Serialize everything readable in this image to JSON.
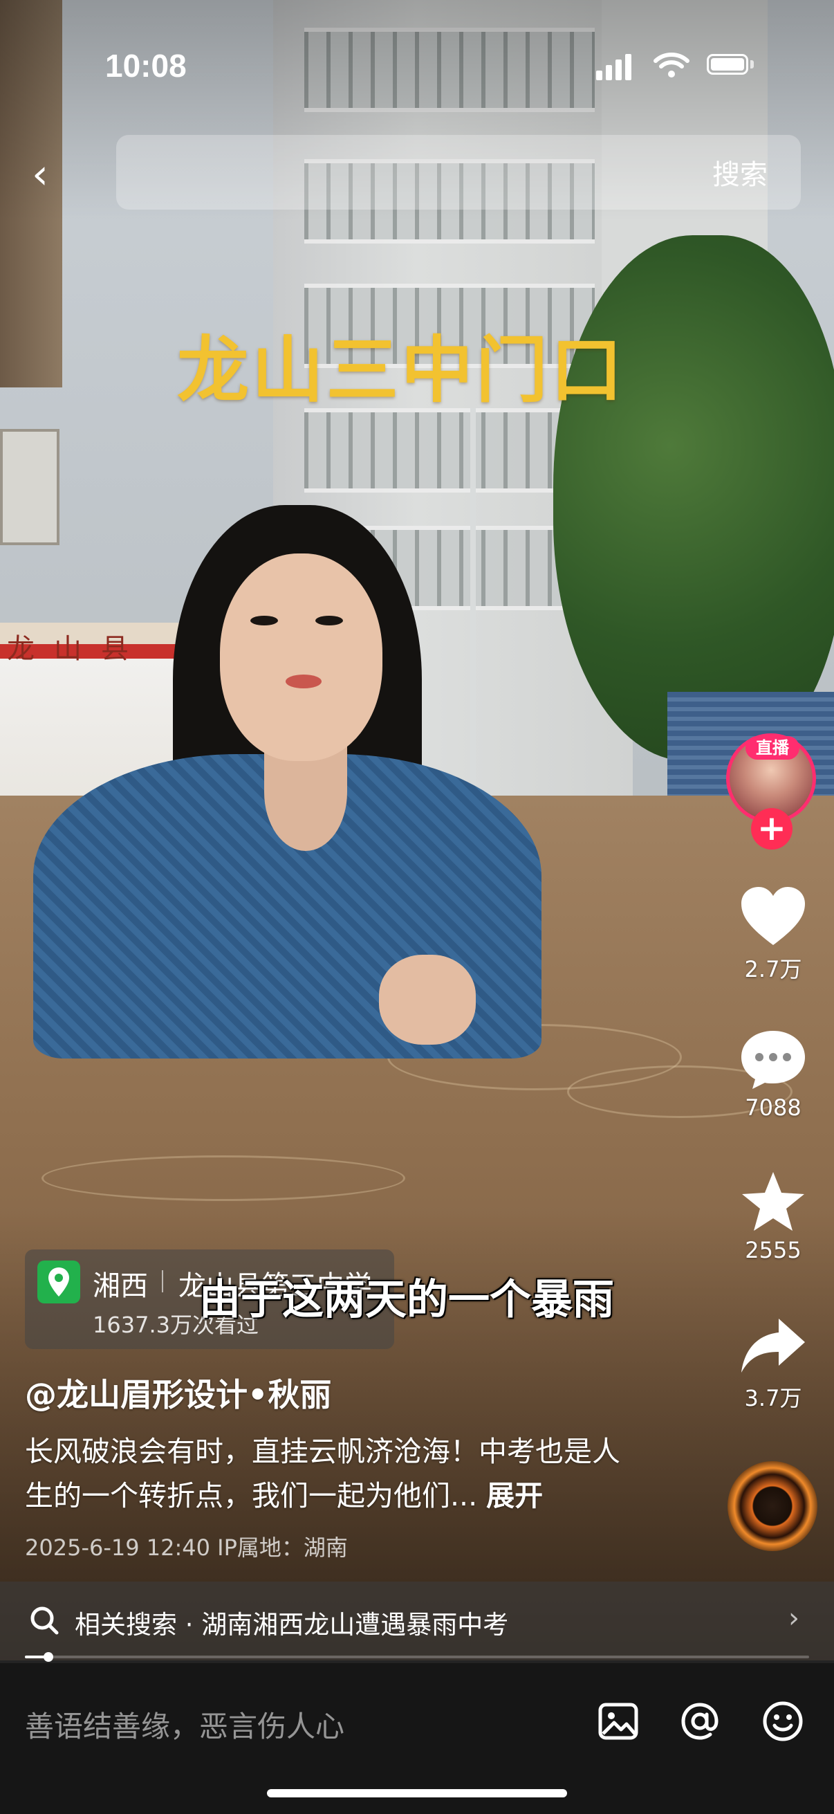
{
  "status_bar": {
    "time": "10:08"
  },
  "search": {
    "button_label": "搜索",
    "back_icon": "‹"
  },
  "video": {
    "overlay_title": "龙山三中门口",
    "subtitle": "由于这两天的一个暴雨",
    "scene_sign": "龙山县"
  },
  "actions": {
    "live_badge": "直播",
    "follow_symbol": "+",
    "likes": "2.7万",
    "comments": "7088",
    "favorites": "2555",
    "shares": "3.7万"
  },
  "poi": {
    "region": "湘西",
    "name": "龙山县第三中学",
    "views": "1637.3万次看过"
  },
  "post": {
    "author": "@龙山眉形设计•秋丽",
    "description": "长风破浪会有时，直挂云帆济沧海！中考也是人生的一个转折点，我们一起为他们... ",
    "expand_label": "展开",
    "meta": "2025-6-19 12:40   IP属地：湖南"
  },
  "related": {
    "text": "相关搜索 · 湖南湘西龙山遭遇暴雨中考",
    "chevron": "›"
  },
  "playback": {
    "progress_fraction": 0.03
  },
  "comment_bar": {
    "placeholder": "善语结善缘，恶言伤人心"
  },
  "colors": {
    "title_yellow": "#f2c230",
    "live_pink": "#ff2d6f",
    "poi_green": "#22b14c",
    "comment_bar_bg": "#161616"
  },
  "icons": [
    "back-icon",
    "heart-icon",
    "comment-icon",
    "star-icon",
    "share-icon",
    "search-icon",
    "image-icon",
    "at-icon",
    "emoji-icon",
    "location-pin-icon",
    "chevron-right-icon"
  ]
}
